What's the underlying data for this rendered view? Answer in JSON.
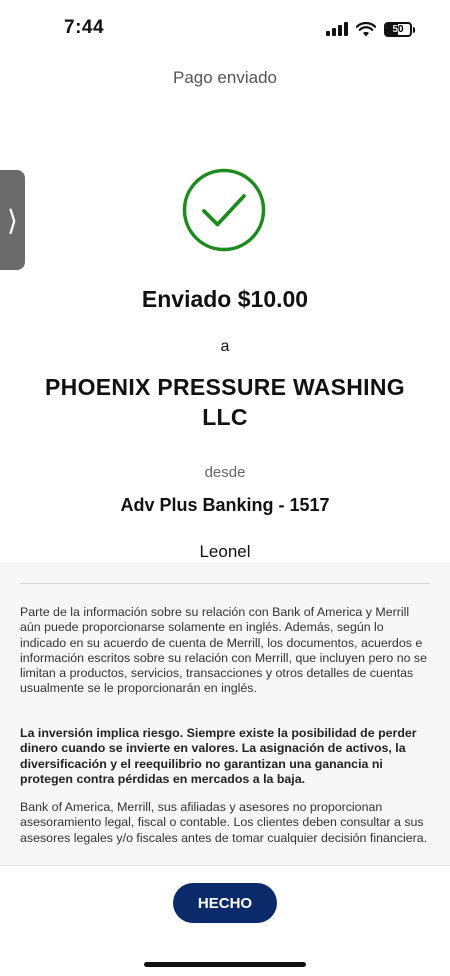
{
  "status_bar": {
    "time": "7:44",
    "battery": "50",
    "icons": [
      "signal-icon",
      "wifi-icon",
      "battery-icon"
    ]
  },
  "header": {
    "title": "Pago enviado"
  },
  "confirmation": {
    "icon": "check-circle-icon",
    "icon_color": "#1f8a1f",
    "sent_amount": "Enviado $10.00",
    "to_label": "a",
    "recipient_line1": "PHOENIX PRESSURE WASHING",
    "recipient_line2": "LLC",
    "from_label": "desde",
    "account": "Adv Plus Banking - 1517",
    "payer_name": "Leonel"
  },
  "disclosures": {
    "paragraph1": "Parte de la información sobre su relación con Bank of America y Merrill aún puede proporcionarse solamente en inglés. Además, según lo indicado en su acuerdo de cuenta de Merrill, los documentos, acuerdos e información escritos sobre su relación con Merrill, que incluyen pero no se limitan a productos, servicios, transacciones y otros detalles de cuentas usualmente se le proporcionarán en inglés.",
    "paragraph2": "La inversión implica riesgo. Siempre existe la posibilidad de perder dinero cuando se invierte en valores. La asignación de activos, la diversificación y el reequilibrio no garantizan una ganancia ni protegen contra pérdidas en mercados a la baja.",
    "paragraph3": "Bank of America, Merrill, sus afiliadas y asesores no proporcionan asesoramiento legal, fiscal o contable. Los clientes deben consultar a sus asesores legales y/o fiscales antes de tomar cualquier decisión financiera."
  },
  "footer": {
    "done_label": "HECHO",
    "done_color": "#0b2a69"
  },
  "side_tab": {
    "icon": "chevron-right-icon"
  }
}
